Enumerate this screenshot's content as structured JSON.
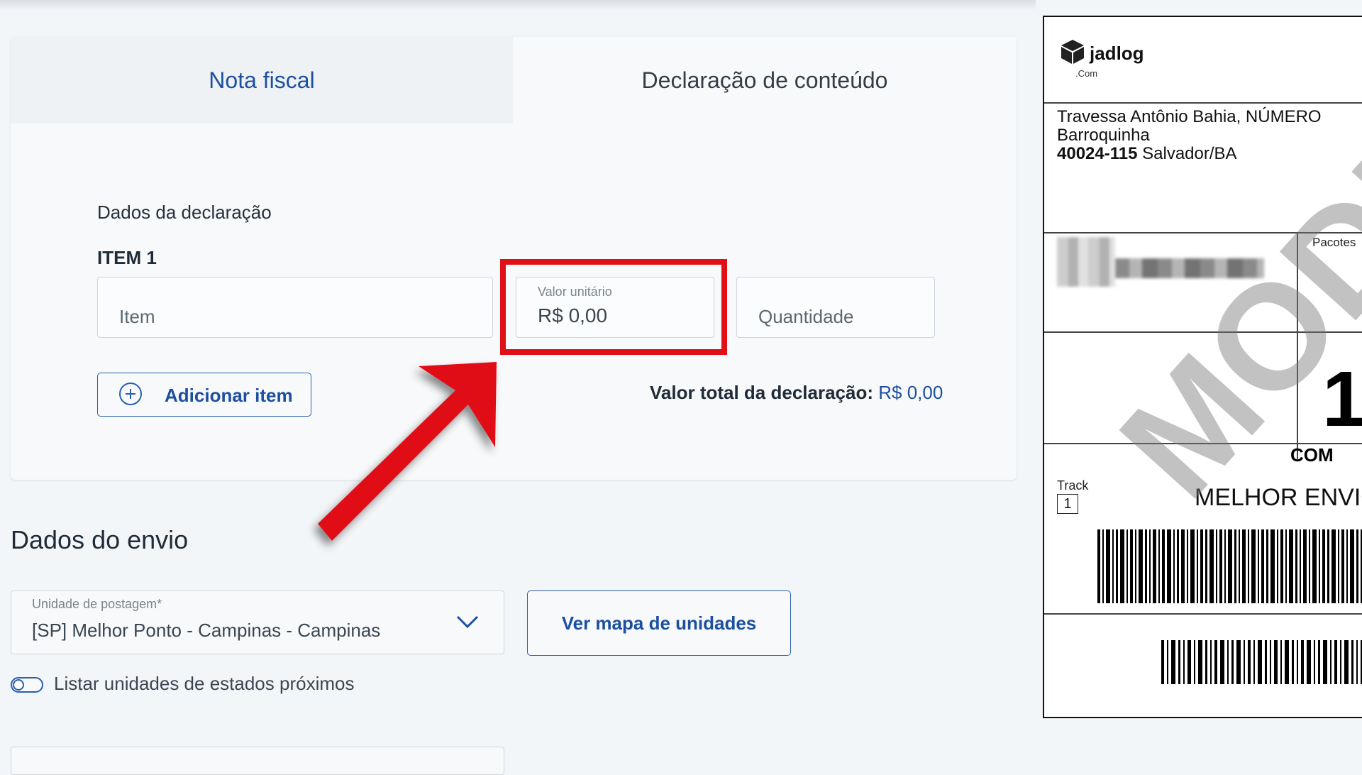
{
  "tabs": [
    {
      "label": "Nota fiscal",
      "active": true
    },
    {
      "label": "Declaração de conteúdo",
      "active": false
    }
  ],
  "declaration": {
    "section_title": "Dados da declaração",
    "item_title": "ITEM 1",
    "item_placeholder": "Item",
    "unit_value_label": "Valor unitário",
    "unit_value": "R$ 0,00",
    "quantity_placeholder": "Quantidade",
    "add_item_label": "Adicionar item",
    "total_label": "Valor total da declaração:",
    "total_value": "R$ 0,00"
  },
  "shipping": {
    "section_title": "Dados do envio",
    "unit_select_label": "Unidade de postagem*",
    "unit_select_value": "[SP] Melhor Ponto - Campinas - Campinas",
    "map_button_label": "Ver mapa de unidades",
    "nearby_toggle_label": "Listar unidades de estados próximos",
    "nearby_toggle_on": false
  },
  "shipping_label": {
    "brand": "jadlog",
    "brand_suffix": ".Com",
    "address_line1": "Travessa Antônio Bahia, NÚMERO",
    "address_line2": "Barroquinha",
    "postal_code": "40024-115",
    "city": "Salvador/BA",
    "packages_label": "Pacotes",
    "package_count": "1",
    "service_text": "COM",
    "track_label": "Track",
    "track_number": "1",
    "carrier_text": "MELHOR ENVIO",
    "watermark": "MODELO"
  },
  "colors": {
    "accent": "#1d4fa0",
    "highlight": "#e10f16",
    "background": "#f3f6f9"
  }
}
